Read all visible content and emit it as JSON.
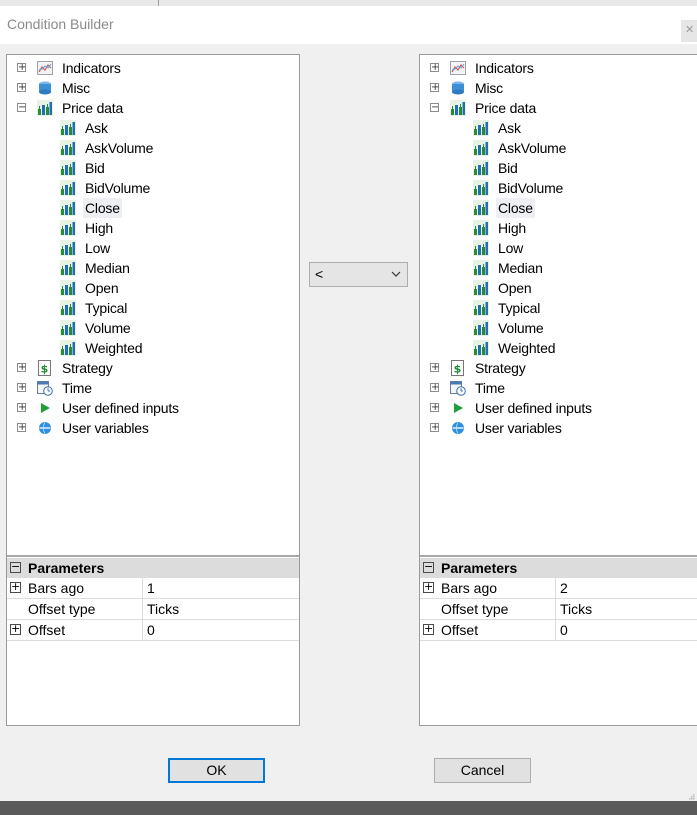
{
  "window": {
    "title": "Condition Builder",
    "close_glyph": "✕"
  },
  "left_tree": {
    "items": [
      {
        "label": "Indicators",
        "icon": "indicators-icon",
        "expander": "+"
      },
      {
        "label": "Misc",
        "icon": "misc-icon",
        "expander": "+"
      },
      {
        "label": "Price data",
        "icon": "price-data-icon",
        "expander": "−"
      },
      {
        "label": "Ask",
        "icon": "price-series-icon"
      },
      {
        "label": "AskVolume",
        "icon": "price-series-icon"
      },
      {
        "label": "Bid",
        "icon": "price-series-icon"
      },
      {
        "label": "BidVolume",
        "icon": "price-series-icon"
      },
      {
        "label": "Close",
        "icon": "price-series-icon",
        "selected": true
      },
      {
        "label": "High",
        "icon": "price-series-icon"
      },
      {
        "label": "Low",
        "icon": "price-series-icon"
      },
      {
        "label": "Median",
        "icon": "price-series-icon"
      },
      {
        "label": "Open",
        "icon": "price-series-icon"
      },
      {
        "label": "Typical",
        "icon": "price-series-icon"
      },
      {
        "label": "Volume",
        "icon": "price-series-icon"
      },
      {
        "label": "Weighted",
        "icon": "price-series-icon"
      },
      {
        "label": "Strategy",
        "icon": "strategy-icon",
        "expander": "+"
      },
      {
        "label": "Time",
        "icon": "time-icon",
        "expander": "+"
      },
      {
        "label": "User defined inputs",
        "icon": "play-icon",
        "expander": "+"
      },
      {
        "label": "User variables",
        "icon": "globe-icon",
        "expander": "+"
      }
    ]
  },
  "right_tree": {
    "items": [
      {
        "label": "Indicators",
        "icon": "indicators-icon",
        "expander": "+"
      },
      {
        "label": "Misc",
        "icon": "misc-icon",
        "expander": "+"
      },
      {
        "label": "Price data",
        "icon": "price-data-icon",
        "expander": "−"
      },
      {
        "label": "Ask",
        "icon": "price-series-icon"
      },
      {
        "label": "AskVolume",
        "icon": "price-series-icon"
      },
      {
        "label": "Bid",
        "icon": "price-series-icon"
      },
      {
        "label": "BidVolume",
        "icon": "price-series-icon"
      },
      {
        "label": "Close",
        "icon": "price-series-icon",
        "selected": true
      },
      {
        "label": "High",
        "icon": "price-series-icon"
      },
      {
        "label": "Low",
        "icon": "price-series-icon"
      },
      {
        "label": "Median",
        "icon": "price-series-icon"
      },
      {
        "label": "Open",
        "icon": "price-series-icon"
      },
      {
        "label": "Typical",
        "icon": "price-series-icon"
      },
      {
        "label": "Volume",
        "icon": "price-series-icon"
      },
      {
        "label": "Weighted",
        "icon": "price-series-icon"
      },
      {
        "label": "Strategy",
        "icon": "strategy-icon",
        "expander": "+"
      },
      {
        "label": "Time",
        "icon": "time-icon",
        "expander": "+"
      },
      {
        "label": "User defined inputs",
        "icon": "play-icon",
        "expander": "+"
      },
      {
        "label": "User variables",
        "icon": "globe-icon",
        "expander": "+"
      }
    ]
  },
  "left_params": {
    "header": "Parameters",
    "header_glyph": "−",
    "rows": [
      {
        "name": "Bars ago",
        "value": "1",
        "expandable": true
      },
      {
        "name": "Offset type",
        "value": "Ticks",
        "expandable": false
      },
      {
        "name": "Offset",
        "value": "0",
        "expandable": true
      }
    ]
  },
  "right_params": {
    "header": "Parameters",
    "header_glyph": "−",
    "rows": [
      {
        "name": "Bars ago",
        "value": "2",
        "expandable": true
      },
      {
        "name": "Offset type",
        "value": "Ticks",
        "expandable": false
      },
      {
        "name": "Offset",
        "value": "0",
        "expandable": true
      }
    ]
  },
  "operator": {
    "value": "<"
  },
  "buttons": {
    "ok": "OK",
    "cancel": "Cancel"
  },
  "colors": {
    "accent": "#0078d7",
    "title_text": "#8a8a8a",
    "param_header": "#dcdcdc"
  }
}
